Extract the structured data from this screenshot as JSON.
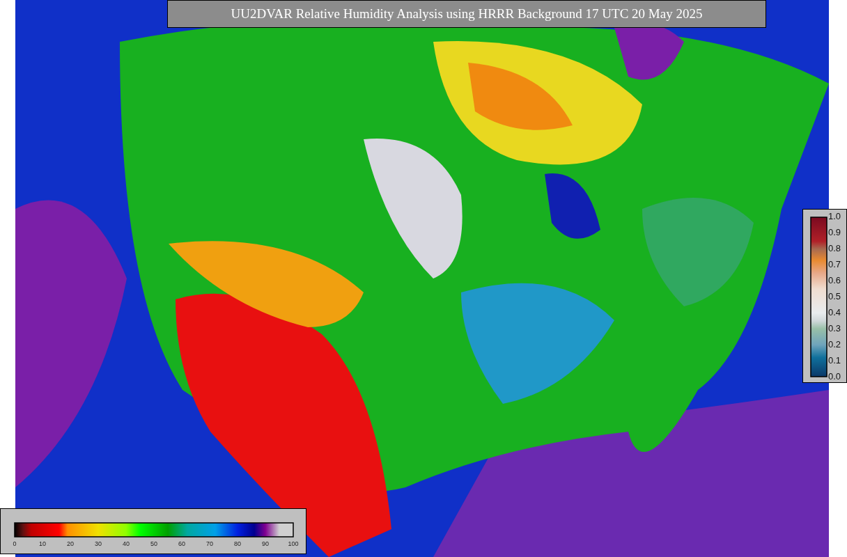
{
  "title": "UU2DVAR Relative Humidity Analysis using HRRR Background 17 UTC 20 May 2025",
  "humidity_colorbar": {
    "tick_labels": [
      "0",
      "10",
      "20",
      "30",
      "40",
      "50",
      "60",
      "70",
      "80",
      "90",
      "100"
    ]
  },
  "observation_colorbar": {
    "tick_labels": [
      "1.0",
      "0.9",
      "0.8",
      "0.7",
      "0.6",
      "0.5",
      "0.4",
      "0.3",
      "0.2",
      "0.1",
      "0.0"
    ]
  }
}
